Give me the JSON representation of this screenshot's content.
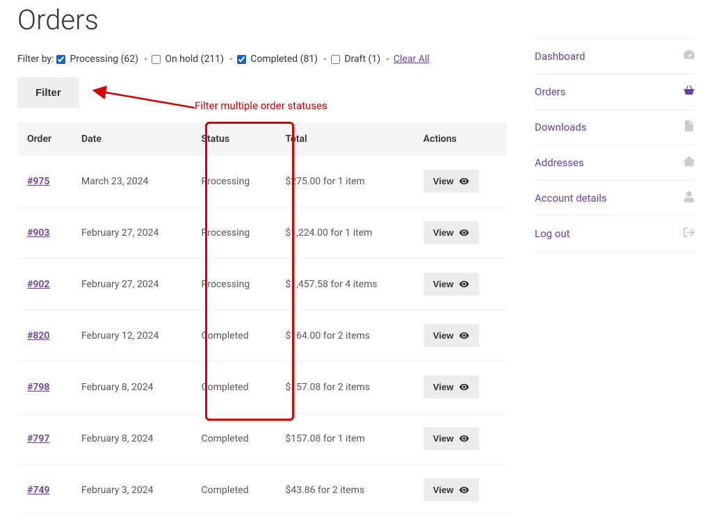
{
  "page": {
    "title": "Orders"
  },
  "filter": {
    "label": "Filter by:",
    "options": [
      {
        "label": "Processing",
        "count": 62,
        "checked": true
      },
      {
        "label": "On hold",
        "count": 211,
        "checked": false
      },
      {
        "label": "Completed",
        "count": 81,
        "checked": true
      },
      {
        "label": "Draft",
        "count": 1,
        "checked": false
      }
    ],
    "clear_all": "Clear All",
    "button": "Filter"
  },
  "annotation": {
    "text": "Filter multiple order statuses"
  },
  "table": {
    "headers": {
      "order": "Order",
      "date": "Date",
      "status": "Status",
      "total": "Total",
      "actions": "Actions"
    },
    "view_label": "View",
    "rows": [
      {
        "order": "#975",
        "date": "March 23, 2024",
        "status": "Processing",
        "total": "$275.00 for 1 item"
      },
      {
        "order": "#903",
        "date": "February 27, 2024",
        "status": "Processing",
        "total": "$1,224.00 for 1 item"
      },
      {
        "order": "#902",
        "date": "February 27, 2024",
        "status": "Processing",
        "total": "$1,457.58 for 4 items"
      },
      {
        "order": "#820",
        "date": "February 12, 2024",
        "status": "Completed",
        "total": "$164.00 for 2 items"
      },
      {
        "order": "#798",
        "date": "February 8, 2024",
        "status": "Completed",
        "total": "$157.08 for 2 items"
      },
      {
        "order": "#797",
        "date": "February 8, 2024",
        "status": "Completed",
        "total": "$157.08 for 1 item"
      },
      {
        "order": "#749",
        "date": "February 3, 2024",
        "status": "Completed",
        "total": "$43.86 for 2 items"
      }
    ]
  },
  "sidebar": {
    "items": [
      {
        "label": "Dashboard",
        "icon": "dashboard"
      },
      {
        "label": "Orders",
        "icon": "basket",
        "active": true
      },
      {
        "label": "Downloads",
        "icon": "file"
      },
      {
        "label": "Addresses",
        "icon": "home"
      },
      {
        "label": "Account details",
        "icon": "user"
      },
      {
        "label": "Log out",
        "icon": "logout"
      }
    ]
  }
}
